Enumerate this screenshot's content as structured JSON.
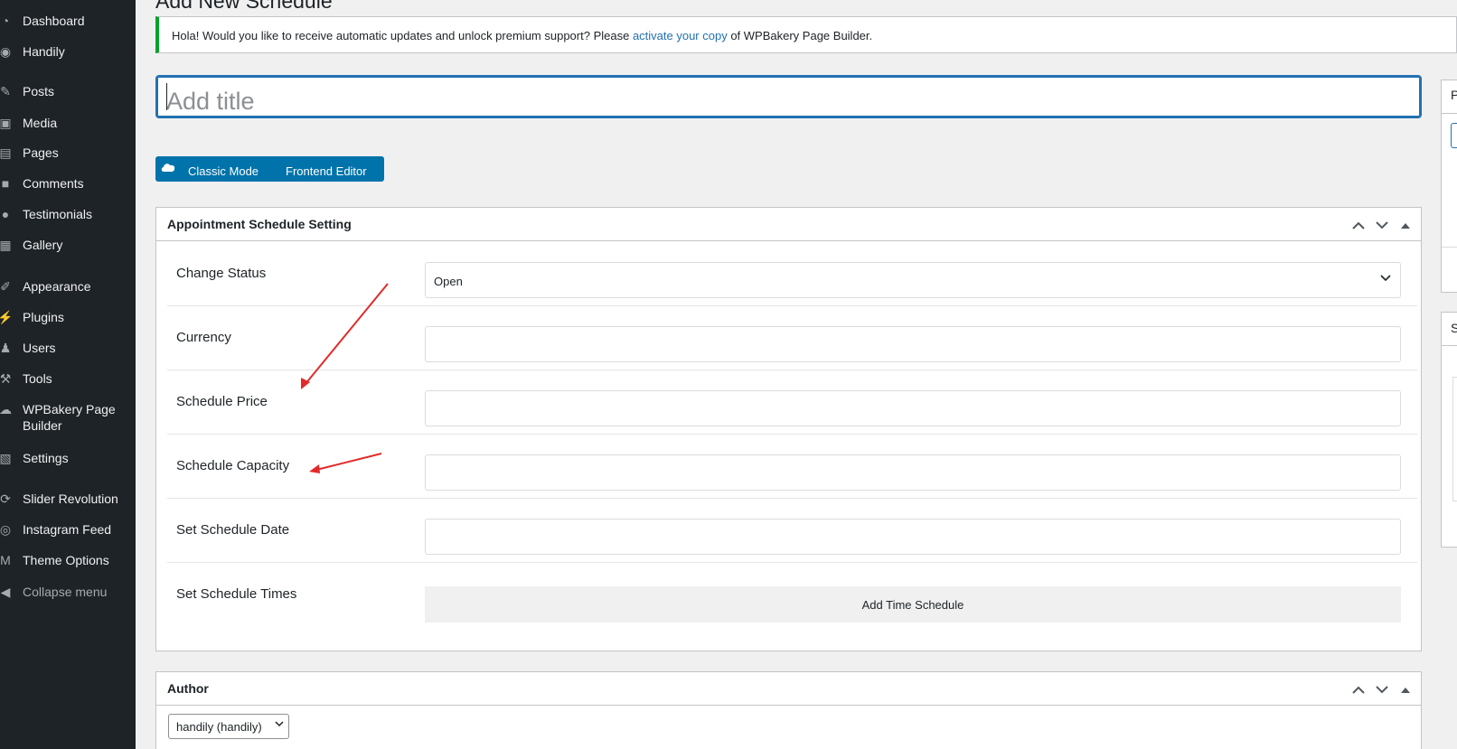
{
  "sidebar": {
    "items": [
      {
        "label": "Dashboard",
        "icon": "dashboard-icon",
        "glyph": "◔"
      },
      {
        "label": "Handily",
        "icon": "handily-icon",
        "glyph": "◉"
      },
      {
        "label": "Posts",
        "icon": "pin-icon",
        "glyph": "✎"
      },
      {
        "label": "Media",
        "icon": "media-icon",
        "glyph": "▣"
      },
      {
        "label": "Pages",
        "icon": "pages-icon",
        "glyph": "▤"
      },
      {
        "label": "Comments",
        "icon": "comments-icon",
        "glyph": "■"
      },
      {
        "label": "Testimonials",
        "icon": "testimonials-icon",
        "glyph": "●"
      },
      {
        "label": "Gallery",
        "icon": "gallery-icon",
        "glyph": "▦"
      },
      {
        "label": "Appearance",
        "icon": "appearance-icon",
        "glyph": "✐"
      },
      {
        "label": "Plugins",
        "icon": "plugins-icon",
        "glyph": "⚡"
      },
      {
        "label": "Users",
        "icon": "users-icon",
        "glyph": "♟"
      },
      {
        "label": "Tools",
        "icon": "tools-icon",
        "glyph": "⚒"
      },
      {
        "label": "WPBakery Page Builder",
        "icon": "wpbakery-icon",
        "glyph": "☁"
      },
      {
        "label": "Settings",
        "icon": "settings-icon",
        "glyph": "▧"
      },
      {
        "label": "Slider Revolution",
        "icon": "slider-revolution-icon",
        "glyph": "⟳"
      },
      {
        "label": "Instagram Feed",
        "icon": "instagram-icon",
        "glyph": "◎"
      },
      {
        "label": "Theme Options",
        "icon": "theme-options-icon",
        "glyph": "M"
      },
      {
        "label": "Collapse menu",
        "icon": "collapse-icon",
        "glyph": "◀"
      }
    ]
  },
  "page": {
    "heading": "Add New Schedule"
  },
  "notice": {
    "text_before": "Hola! Would you like to receive automatic updates and unlock premium support? Please ",
    "link": "activate your copy",
    "text_after": " of WPBakery Page Builder."
  },
  "title_field": {
    "placeholder": "Add title"
  },
  "wpbakery": {
    "classic_mode": "Classic Mode",
    "frontend_editor": "Frontend Editor"
  },
  "schedule_box": {
    "title": "Appointment Schedule Setting",
    "fields": {
      "status_label": "Change Status",
      "status_value": "Open",
      "currency_label": "Currency",
      "price_label": "Schedule Price",
      "capacity_label": "Schedule Capacity",
      "date_label": "Set Schedule Date",
      "times_label": "Set Schedule Times",
      "add_time_button": "Add Time Schedule"
    }
  },
  "author_box": {
    "title": "Author",
    "selected": "handily (handily)"
  },
  "right_column": {
    "box1_letter": "P",
    "box2_letter": "S"
  },
  "colors": {
    "sidebar_bg": "#1d2327",
    "accent": "#2271b1",
    "wpbakery_blue": "#0073aa",
    "notice_green": "#00a32a",
    "annotation_red": "#e32a2a"
  }
}
